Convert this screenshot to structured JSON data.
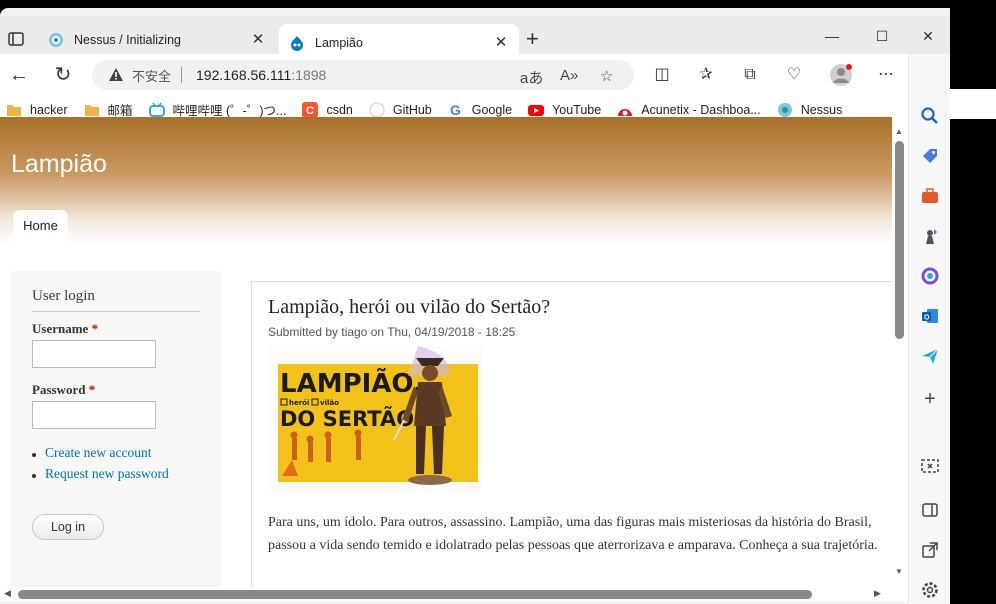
{
  "tabs": [
    {
      "title": "Nessus / Initializing",
      "active": false
    },
    {
      "title": "Lampião",
      "active": true
    }
  ],
  "address": {
    "insecure_label": "不安全",
    "host": "192.168.56.111",
    "port": ":1898"
  },
  "bookmarks": [
    {
      "label": "hacker",
      "icon": "folder-icon",
      "color": "#e8b54a"
    },
    {
      "label": "邮箱",
      "icon": "folder-icon",
      "color": "#e8b54a"
    },
    {
      "label": "哔哩哔哩 (゜-゜)つ...",
      "icon": "bilibili-icon",
      "color": "#20a0d8"
    },
    {
      "label": "csdn",
      "icon": "csdn-icon",
      "color": "#fc5531"
    },
    {
      "label": "GitHub",
      "icon": "github-icon",
      "color": "#222222"
    },
    {
      "label": "Google",
      "icon": "google-icon",
      "color": "#4285f4"
    },
    {
      "label": "YouTube",
      "icon": "youtube-icon",
      "color": "#ff0000"
    },
    {
      "label": "Acunetix - Dashboa...",
      "icon": "acunetix-icon",
      "color": "#d0202e"
    },
    {
      "label": "Nessus",
      "icon": "nessus-icon",
      "color": "#33aacc"
    }
  ],
  "page": {
    "site_name": "Lampião",
    "nav_home": "Home",
    "login": {
      "title": "User login",
      "username_label": "Username",
      "password_label": "Password",
      "required_mark": "*",
      "links": [
        "Create new account",
        "Request new password"
      ],
      "button": "Log in"
    },
    "node": {
      "title": "Lampião, herói ou vilão do Sertão?",
      "submitted": "Submitted by tiago on Thu, 04/19/2018 - 18:25",
      "image_text_line1": "LAMPIÃO,",
      "image_text_line2": "DO SERTÃO",
      "image_small1": "herói",
      "image_small2": "vilão",
      "body": "Para uns, um ídolo. Para outros, assassino. Lampião, uma das figuras mais misteriosas da história do Brasil, passou a vida sendo temido e idolatrado pelas pessoas que aterrorizava e amparava. Conheça a sua trajetória."
    }
  },
  "colors": {
    "header_top": "#a86f2a",
    "link": "#0071b3",
    "required": "#cc0000"
  }
}
